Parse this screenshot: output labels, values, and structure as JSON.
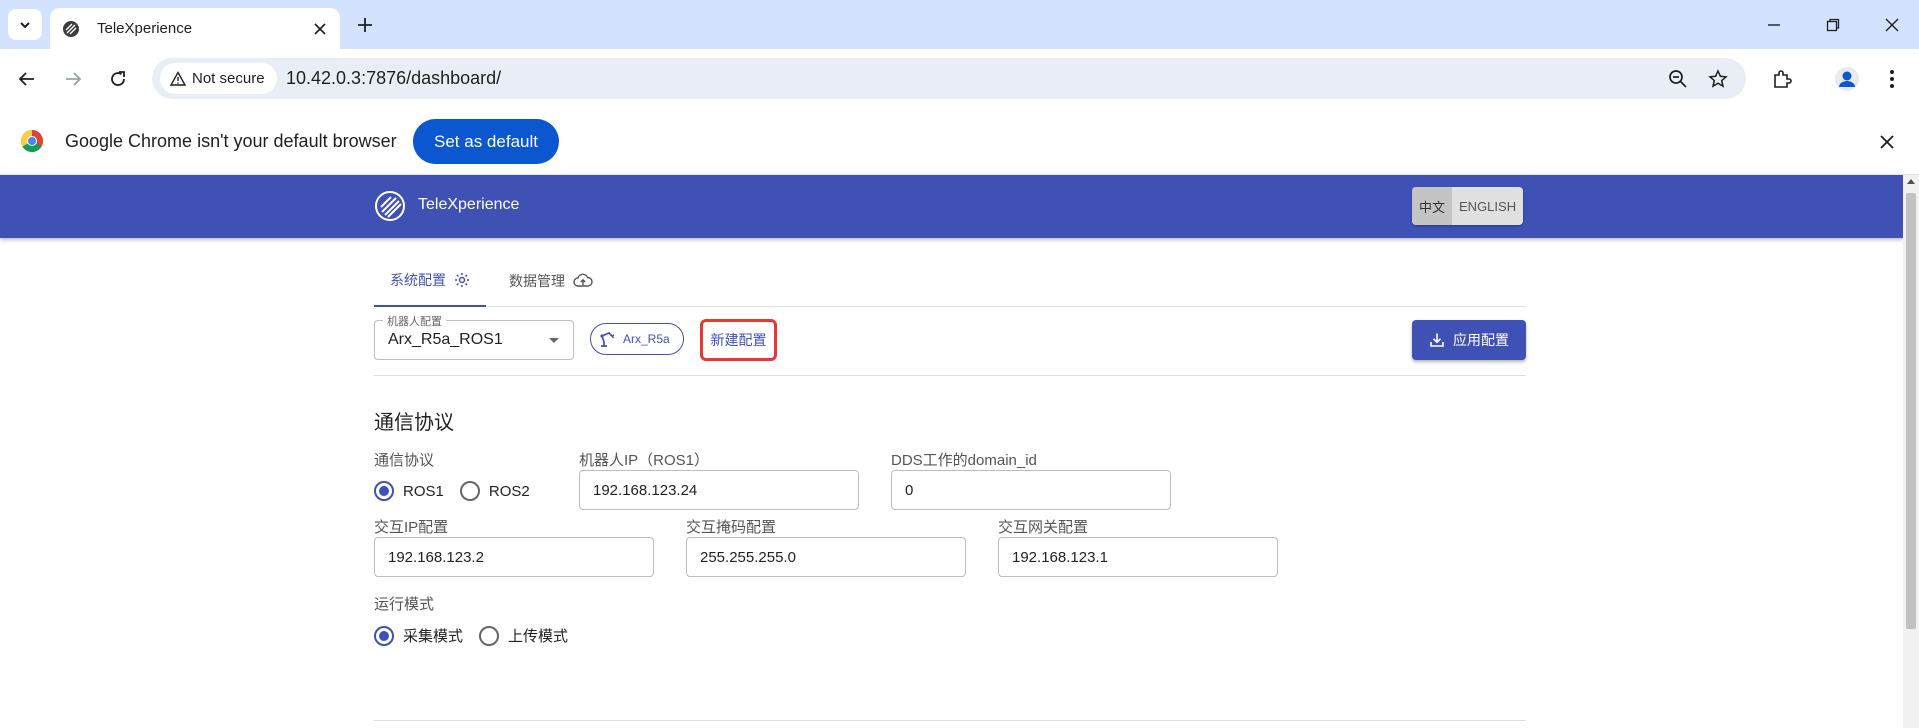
{
  "browser": {
    "tab_title": "TeleXperience",
    "security_label": "Not secure",
    "url": "10.42.0.3:7876/dashboard/",
    "infobar_text": "Google Chrome isn't your default browser",
    "infobar_button": "Set as default"
  },
  "app": {
    "name": "TeleXperience",
    "lang_zh": "中文",
    "lang_en": "ENGLISH"
  },
  "tabs": [
    {
      "label": "系统配置",
      "active": true
    },
    {
      "label": "数据管理",
      "active": false
    }
  ],
  "config_bar": {
    "select_label": "机器人配置",
    "select_value": "Arx_R5a_ROS1",
    "robot_chip": "Arx_R5a",
    "new_config": "新建配置",
    "apply": "应用配置"
  },
  "comm": {
    "section_title": "通信协议",
    "protocol_label": "通信协议",
    "protocol_options": [
      {
        "label": "ROS1",
        "selected": true
      },
      {
        "label": "ROS2",
        "selected": false
      }
    ],
    "robot_ip_label": "机器人IP（ROS1）",
    "robot_ip_value": "192.168.123.24",
    "dds_label": "DDS工作的domain_id",
    "dds_value": "0",
    "inter_ip_label": "交互IP配置",
    "inter_ip_value": "192.168.123.2",
    "mask_label": "交互掩码配置",
    "mask_value": "255.255.255.0",
    "gateway_label": "交互网关配置",
    "gateway_value": "192.168.123.1",
    "mode_label": "运行模式",
    "mode_options": [
      {
        "label": "采集模式",
        "selected": true
      },
      {
        "label": "上传模式",
        "selected": false
      }
    ]
  },
  "colors": {
    "primary": "#3f51b5",
    "chrome_blue": "#0b57d0",
    "highlight_red": "#e53935"
  }
}
